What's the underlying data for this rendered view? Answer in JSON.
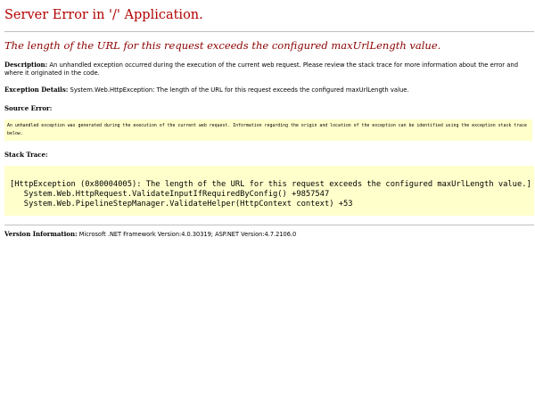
{
  "title": "Server Error in '/' Application.",
  "subtitle": "The length of the URL for this request exceeds the configured maxUrlLength value.",
  "description": {
    "label": "Description:",
    "text": "An unhandled exception occurred during the execution of the current web request. Please review the stack trace for more information about the error and where it originated in the code."
  },
  "exception_details": {
    "label": "Exception Details:",
    "text": "System.Web.HttpException: The length of the URL for this request exceeds the configured maxUrlLength value."
  },
  "source_error": {
    "label": "Source Error:",
    "text": "An unhandled exception was generated during the execution of the current web request. Information regarding the origin and location of the exception can be identified using the exception stack trace below."
  },
  "stack_trace": {
    "label": "Stack Trace:",
    "lines": [
      "[HttpException (0x80004005): The length of the URL for this request exceeds the configured maxUrlLength value.]",
      "   System.Web.HttpRequest.ValidateInputIfRequiredByConfig() +9857547",
      "   System.Web.PipelineStepManager.ValidateHelper(HttpContext context) +53"
    ]
  },
  "version": {
    "label": "Version Information:",
    "text": "Microsoft .NET Framework Version:4.0.30319; ASP.NET Version:4.7.2106.0"
  },
  "colors": {
    "title": "#b30000",
    "subtitle": "#8b0000",
    "code_background": "#ffffcc",
    "rule": "#c0c0c0"
  }
}
